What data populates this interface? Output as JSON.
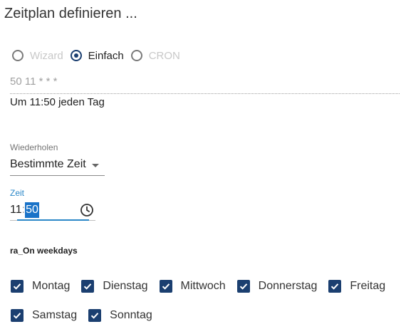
{
  "dialog": {
    "title": "Zeitplan definieren ..."
  },
  "mode": {
    "options": [
      {
        "label": "Wizard",
        "checked": false,
        "disabled": true
      },
      {
        "label": "Einfach",
        "checked": true,
        "disabled": false
      },
      {
        "label": "CRON",
        "checked": false,
        "disabled": true
      }
    ]
  },
  "cron": {
    "value": "50 11 * * *"
  },
  "summary": {
    "text": "Um 11:50 jeden Tag"
  },
  "repeat": {
    "label": "Wiederholen",
    "value": "Bestimmte Zeit"
  },
  "time": {
    "label": "Zeit",
    "hour": "11",
    "separator": ":",
    "minute": "50"
  },
  "weekdays": {
    "title": "ra_On weekdays",
    "items": [
      {
        "label": "Montag",
        "checked": true
      },
      {
        "label": "Dienstag",
        "checked": true
      },
      {
        "label": "Mittwoch",
        "checked": true
      },
      {
        "label": "Donnerstag",
        "checked": true
      },
      {
        "label": "Freitag",
        "checked": true
      },
      {
        "label": "Samstag",
        "checked": true
      },
      {
        "label": "Sonntag",
        "checked": true
      }
    ]
  },
  "colors": {
    "accent": "#1b3f70",
    "focus": "#2b88c8",
    "selection": "#1a73c8"
  }
}
